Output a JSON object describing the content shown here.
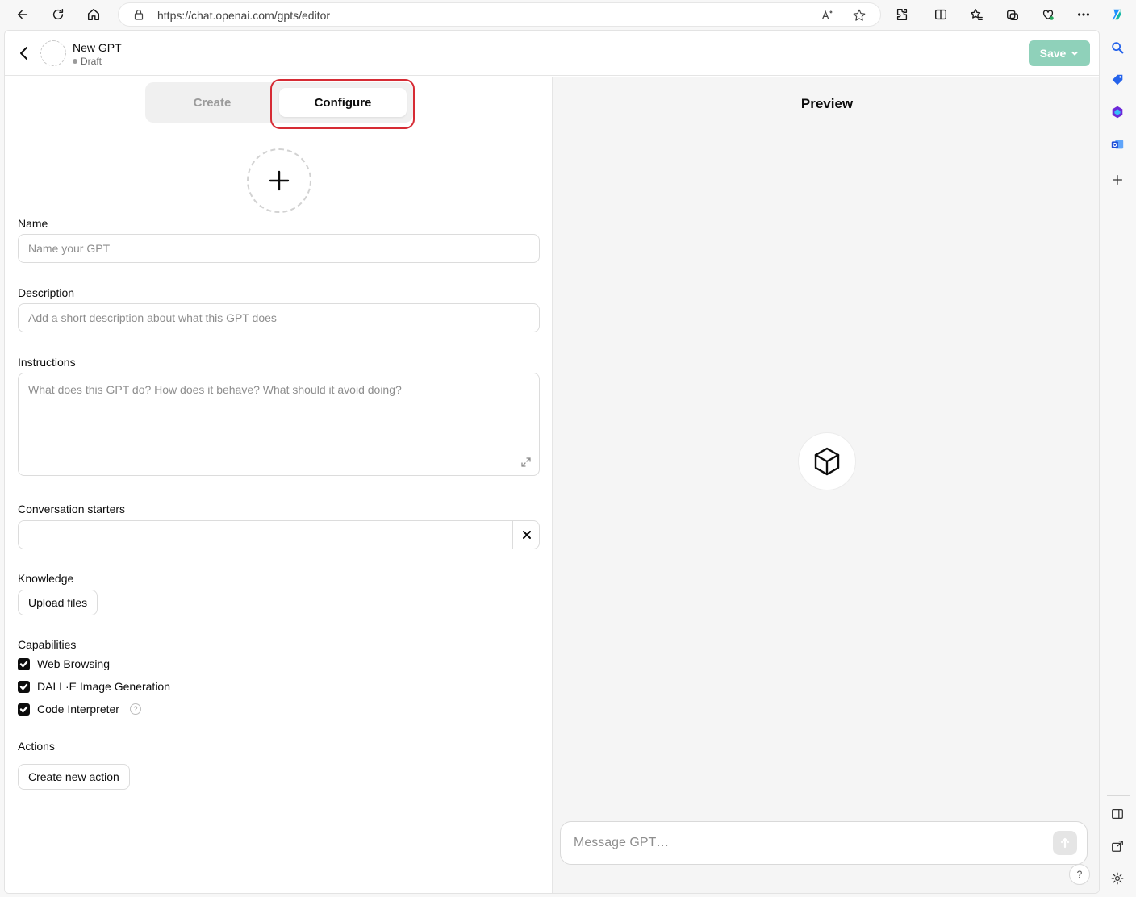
{
  "browser": {
    "url": "https://chat.openai.com/gpts/editor"
  },
  "header": {
    "title": "New GPT",
    "status": "Draft",
    "save_label": "Save"
  },
  "tabs": {
    "create": "Create",
    "configure": "Configure",
    "active": "Configure"
  },
  "form": {
    "name": {
      "label": "Name",
      "placeholder": "Name your GPT",
      "value": ""
    },
    "description": {
      "label": "Description",
      "placeholder": "Add a short description about what this GPT does",
      "value": ""
    },
    "instructions": {
      "label": "Instructions",
      "placeholder": "What does this GPT do? How does it behave? What should it avoid doing?",
      "value": ""
    },
    "conversation_starters": {
      "label": "Conversation starters",
      "value": ""
    },
    "knowledge": {
      "label": "Knowledge",
      "upload_label": "Upload files"
    },
    "capabilities": {
      "label": "Capabilities",
      "items": [
        {
          "label": "Web Browsing",
          "checked": true
        },
        {
          "label": "DALL·E Image Generation",
          "checked": true
        },
        {
          "label": "Code Interpreter",
          "checked": true
        }
      ]
    },
    "actions": {
      "label": "Actions",
      "create_label": "Create new action"
    }
  },
  "preview": {
    "title": "Preview",
    "message_placeholder": "Message GPT…",
    "help_label": "?"
  },
  "colors": {
    "save_button": "#8fd1ba",
    "highlight_ring": "#d62b34",
    "checkbox": "#0d0d0d"
  }
}
